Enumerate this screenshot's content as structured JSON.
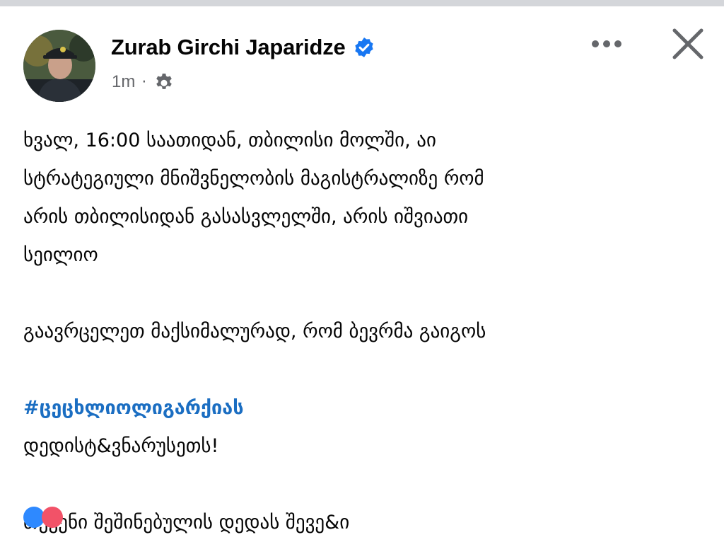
{
  "post": {
    "author": "Zurab Girchi Japaridze",
    "verified": true,
    "time": "1m",
    "separator": "·",
    "audience_icon": "gear-icon",
    "lines": [
      "ხვალ, 16:00 საათიდან, თბილისი მოლში, აი",
      "სტრატეგიული მნიშვნელობის მაგისტრალიზე რომ",
      "არის თბილისიდან გასასვლელში, არის იშვიათი",
      "სეილიო",
      "",
      "გაავრცელეთ მაქსიმალურად, რომ ბევრმა გაიგოს",
      "",
      "#ცეცხლიოლიგარქიას",
      "დედისტ&ვნარუსეთს!",
      "",
      "თქვენი შეშინებულის დედას შევე&ი"
    ]
  },
  "controls": {
    "more_icon": "more-horizontal-icon",
    "close_icon": "close-icon"
  },
  "colors": {
    "hashtag": "#1b6ec2",
    "verified": "#1877f2",
    "meta": "#65676b",
    "top_strip": "#d4d6da"
  }
}
